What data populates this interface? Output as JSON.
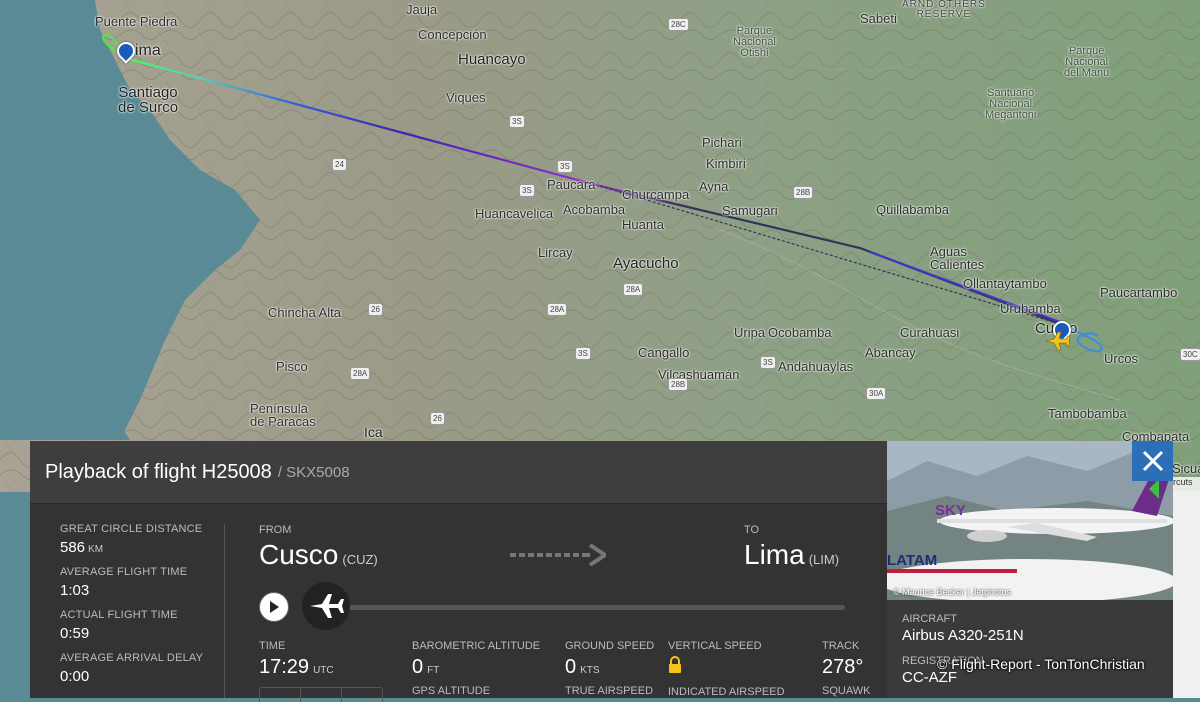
{
  "map": {
    "labels": {
      "puente_piedra": "Puente Piedra",
      "jauja": "Jauja",
      "lima_map": "ima",
      "concepcion": "Concepción",
      "huancayo": "Huancayo",
      "santiago_de_surco": "Santiago\nde Surco",
      "viques": "Viques",
      "paucara": "Paucara",
      "churcampa": "Churcampa",
      "acobamba": "Acobamba",
      "huancavelica": "Huancavelica",
      "huanta": "Huanta",
      "lircay": "Lircay",
      "ayacucho": "Ayacucho",
      "chincha_alta": "Chincha Alta",
      "pisco": "Pisco",
      "peninsula_de_paracas": "Península\nde Paracas",
      "ica": "Ica",
      "cangallo": "Cangallo",
      "vilcashuaman": "Vilcashuamán",
      "andahuaylas": "Andahuaylas",
      "abancay": "Abancay",
      "uripa": "Uripa",
      "ocobamba": "Ocobamba",
      "curahuasi": "Curahuasi",
      "pichari": "Pichari",
      "kimbiri": "Kimbiri",
      "ayna": "Ayna",
      "samugari": "Samugari",
      "quillabamba": "Quillabamba",
      "aguas_calientes": "Aguas\nCalientes",
      "ollantaytambo": "Ollantaytambo",
      "urubamba": "Urubamba",
      "cusco_map": "Cusco",
      "urcos": "Urcos",
      "paucartambo": "Paucartambo",
      "tambobamba": "Tambobamba",
      "combapata": "Combapata",
      "sabeti": "Sabeti",
      "otishi": "Parque\nNacional\nOtishi",
      "manu": "Parque\nNacional\ndel Manu",
      "megantoni": "Santuario\nNacional\nMegantoni",
      "reserve": "ARND OTHERS\nRESERVE",
      "sicua": "Sicua"
    },
    "shields": [
      "28C",
      "3S",
      "28B",
      "3S",
      "24",
      "26",
      "28A",
      "28A",
      "28A",
      "3S",
      "3S",
      "30A",
      "30C",
      "26",
      "28B",
      "3S"
    ]
  },
  "panel": {
    "title": "Playback of flight H25008",
    "callsign": "/ SKX5008"
  },
  "stats": {
    "great_circle_label": "GREAT CIRCLE DISTANCE",
    "great_circle_value": "586",
    "great_circle_unit": "KM",
    "avg_flight_label": "AVERAGE FLIGHT TIME",
    "avg_flight_value": "1:03",
    "actual_flight_label": "ACTUAL FLIGHT TIME",
    "actual_flight_value": "0:59",
    "avg_delay_label": "AVERAGE ARRIVAL DELAY",
    "avg_delay_value": "0:00"
  },
  "route": {
    "from_label": "FROM",
    "from_city": "Cusco",
    "from_code": "(CUZ)",
    "to_label": "TO",
    "to_city": "Lima",
    "to_code": "(LIM)"
  },
  "metrics": {
    "time_label": "TIME",
    "time_value": "17:29",
    "time_unit": "UTC",
    "baro_label": "BAROMETRIC ALTITUDE",
    "baro_value": "0",
    "baro_unit": "FT",
    "gps_label": "GPS ALTITUDE",
    "ground_speed_label": "GROUND SPEED",
    "ground_speed_value": "0",
    "ground_speed_unit": "KTS",
    "true_airspeed_label": "TRUE AIRSPEED",
    "vertical_speed_label": "VERTICAL SPEED",
    "indicated_airspeed_label": "INDICATED AIRSPEED",
    "track_label": "TRACK",
    "track_value": "278°",
    "squawk_label": "SQUAWK"
  },
  "aircraft": {
    "photo_credit": "© Maurice Becker | Jetphotos",
    "aircraft_label": "AIRCRAFT",
    "aircraft_value": "Airbus A320-251N",
    "registration_label": "REGISTRATION",
    "registration_value": "CC-AZF",
    "livery_text_sky": "SKY",
    "livery_text_latam": "LATAM"
  },
  "attribution": "rcuts",
  "watermark": "© Flight-Report - TonTonChristian",
  "colors": {
    "ocean": "#5b8a97",
    "panel_bg": "#333333",
    "panel_header": "#3e3e3e",
    "close_button": "#2b6fb8",
    "marker": "#1a5ab8",
    "plane_icon": "#f5c518"
  }
}
